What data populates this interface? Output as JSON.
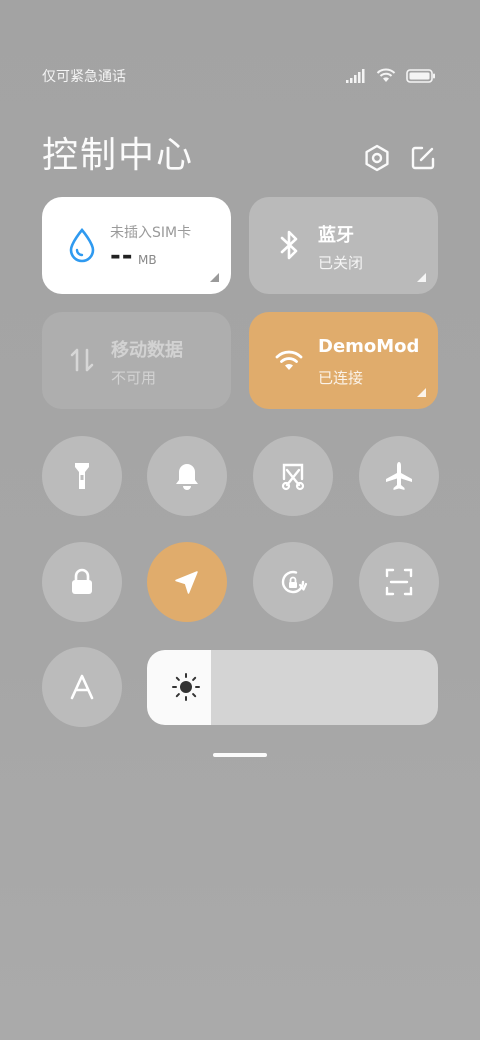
{
  "status": {
    "carrier": "仅可紧急通话",
    "icons": [
      "signal-icon",
      "wifi-icon",
      "battery-icon"
    ]
  },
  "header": {
    "title": "控制中心",
    "buttons": [
      "settings-icon",
      "edit-icon"
    ]
  },
  "tiles": {
    "data_usage": {
      "label": "未插入SIM卡",
      "value": "--",
      "unit": "MB",
      "icon": "water-drop-icon"
    },
    "bluetooth": {
      "title": "蓝牙",
      "subtitle": "已关闭",
      "icon": "bluetooth-icon"
    },
    "mobile_data": {
      "title": "移动数据",
      "subtitle": "不可用",
      "icon": "mobile-data-icon"
    },
    "wifi": {
      "title": "DemoMod",
      "subtitle": "已连接",
      "icon": "wifi-icon"
    }
  },
  "toggles": [
    {
      "name": "flashlight",
      "icon": "flashlight-icon",
      "active": false
    },
    {
      "name": "silent",
      "icon": "bell-icon",
      "active": false
    },
    {
      "name": "screenshot",
      "icon": "scissors-icon",
      "active": false
    },
    {
      "name": "airplane",
      "icon": "airplane-icon",
      "active": false
    },
    {
      "name": "lock-screen",
      "icon": "lock-icon",
      "active": false
    },
    {
      "name": "location",
      "icon": "location-arrow-icon",
      "active": true
    },
    {
      "name": "auto-rotate",
      "icon": "rotate-lock-icon",
      "active": false
    },
    {
      "name": "scanner",
      "icon": "scan-icon",
      "active": false
    },
    {
      "name": "font-size",
      "icon": "font-a-icon",
      "active": false
    }
  ],
  "brightness": {
    "level": 0.22,
    "icon": "sun-icon"
  },
  "colors": {
    "accent": "#e0ac6c",
    "tile_white": "#ffffff",
    "bluetooth_blue": "#2f9af0"
  }
}
